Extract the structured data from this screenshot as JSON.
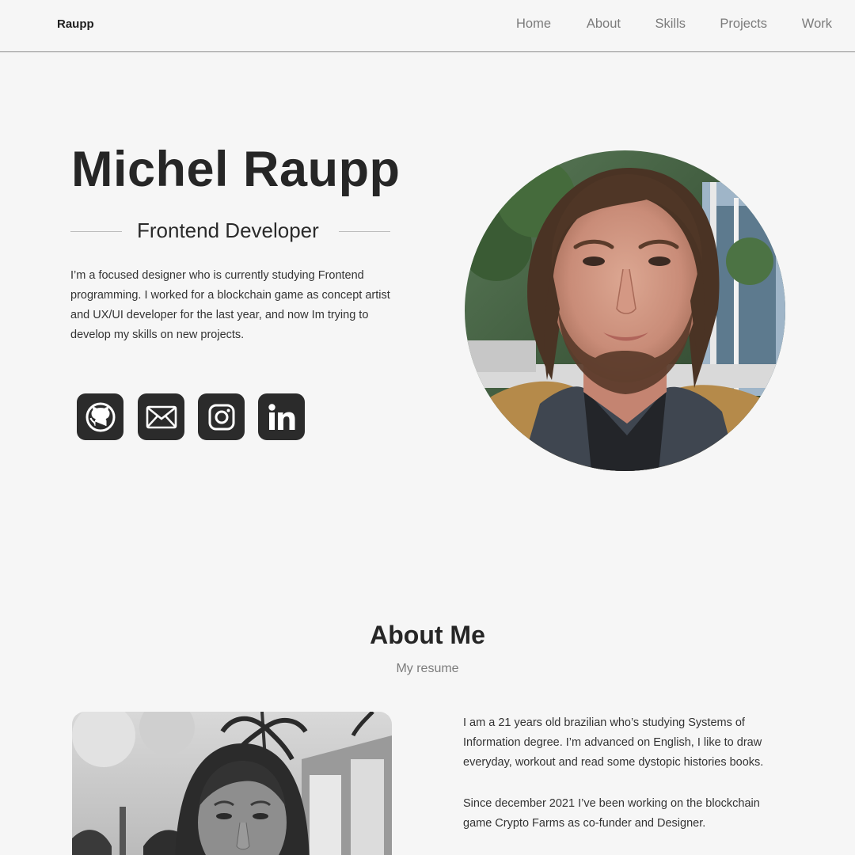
{
  "header": {
    "logo": "Raupp",
    "nav": [
      "Home",
      "About",
      "Skills",
      "Projects",
      "Work"
    ]
  },
  "hero": {
    "name": "Michel Raupp",
    "role": "Frontend Developer",
    "bio": "I’m a focused designer who is currently studying Frontend programming. I worked for a blockchain game as concept artist and UX/UI developer for the last year, and now Im trying to develop my skills on new projects.",
    "socials": [
      {
        "icon": "github-icon"
      },
      {
        "icon": "mail-icon"
      },
      {
        "icon": "instagram-icon"
      },
      {
        "icon": "linkedin-icon"
      }
    ]
  },
  "about": {
    "title": "About Me",
    "subtitle": "My resume",
    "paragraphs": [
      "I am a 21 years old brazilian who’s studying Systems of Information degree. I’m advanced on English, I like to draw everyday, workout and read some dystopic histories books.",
      "Since december 2021 I’ve been working on the blockchain game Crypto Farms as co-funder and Designer."
    ]
  },
  "colors": {
    "background": "#f6f6f6",
    "text": "#262626",
    "nav_text": "#7b7b7b",
    "icon_bg": "#2b2b2b",
    "header_border": "#8a8a8a"
  }
}
